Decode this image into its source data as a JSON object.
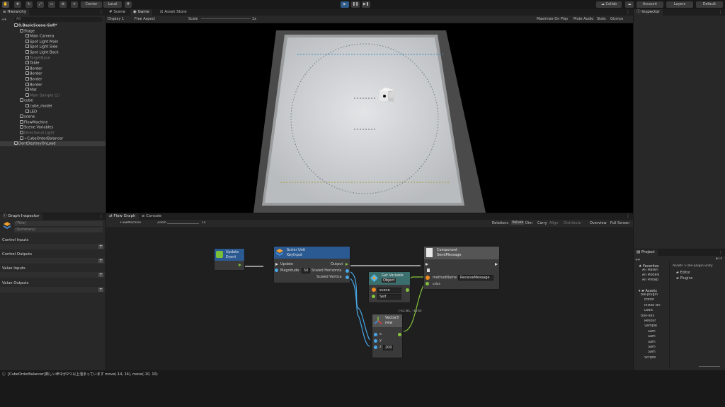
{
  "toolbar": {
    "center_label": "Center",
    "local_label": "Local",
    "collab_label": "Collab",
    "account_label": "Account",
    "layers_label": "Layers",
    "layout_label": "Default"
  },
  "hierarchy": {
    "tab_label": "Hierarchy",
    "search_placeholder": "All",
    "items": [
      {
        "label": "0.BasicScene-Sofi*",
        "indent": 0,
        "bold": true
      },
      {
        "label": "Stage",
        "indent": 1
      },
      {
        "label": "Main Camera",
        "indent": 2
      },
      {
        "label": "Spot Light Main",
        "indent": 2
      },
      {
        "label": "Spot Light Side",
        "indent": 2
      },
      {
        "label": "Spot Light Back",
        "indent": 2
      },
      {
        "label": "TargetBase",
        "indent": 2,
        "dim": true
      },
      {
        "label": "Table",
        "indent": 2
      },
      {
        "label": "Border",
        "indent": 2
      },
      {
        "label": "Border",
        "indent": 2
      },
      {
        "label": "Border",
        "indent": 2
      },
      {
        "label": "Border",
        "indent": 2
      },
      {
        "label": "Mat",
        "indent": 2
      },
      {
        "label": "Main Sample (1)",
        "indent": 2,
        "dim": true
      },
      {
        "label": "cube",
        "indent": 1
      },
      {
        "label": "cube_model",
        "indent": 2
      },
      {
        "label": "LED",
        "indent": 2
      },
      {
        "label": "scene",
        "indent": 1
      },
      {
        "label": "FlowMachine",
        "indent": 1
      },
      {
        "label": "Scene Variables",
        "indent": 1
      },
      {
        "label": "Directional Light",
        "indent": 1,
        "dim": true
      },
      {
        "label": "~CubeOrderBalancer",
        "indent": 1
      },
      {
        "label": "DontDestroyOnLoad",
        "indent": 0,
        "sel": true
      }
    ]
  },
  "scene_tabs": [
    "Scene",
    "Game",
    "Asset Store"
  ],
  "game_toolbar": {
    "display": "Display 1",
    "aspect": "Free Aspect",
    "scale_label": "Scale",
    "scale_value": "1x",
    "maximize": "Maximize On Play",
    "mute": "Mute Audio",
    "stats": "Stats",
    "gizmos": "Gizmos"
  },
  "inspector": {
    "tab_label": "Inspector"
  },
  "graph_inspector": {
    "tab_label": "Graph Inspector",
    "title_placeholder": "(Title)",
    "summary_placeholder": "(Summary)",
    "sections": [
      "Control Inputs",
      "Control Outputs",
      "Value Inputs",
      "Value Outputs"
    ]
  },
  "flow_tabs": [
    "Flow Graph",
    "Console"
  ],
  "flow_toolbar": {
    "graph_name": "FlowMachine",
    "zoom_label": "Zoom",
    "zoom_value": "1x",
    "buttons": [
      "Relations",
      "Values",
      "Dim",
      "Carry",
      "Align",
      "Distribute",
      "Overview",
      "Full Screen"
    ]
  },
  "nodes": {
    "update": {
      "title": "Update",
      "subtitle": "Event"
    },
    "keyinput": {
      "title": "Scrier Unit",
      "subtitle": "KeyInput",
      "in_update": "Update",
      "in_magnitude": "Magnitude",
      "magnitude_value": "50",
      "out_output": "Output",
      "out_h": "Scaled Horizonta",
      "out_v": "Scaled Vertica"
    },
    "getvar": {
      "title": "Get Variable",
      "subtitle": "Object",
      "kind": "Object",
      "name_value": "scene",
      "target_value": "Self"
    },
    "sendmsg": {
      "title": "Component",
      "subtitle": "SendMessage",
      "param_label": "methodName",
      "method_value": "ReceiveMessage",
      "value_label": "value"
    },
    "vector": {
      "title": "Vector3",
      "subtitle": "new",
      "x_label": "x",
      "y_label": "y",
      "z_label": "z",
      "z_value": "200"
    },
    "vector_readout": "(-11.61, -10.6)"
  },
  "project": {
    "tab_label": "Project",
    "count": "14",
    "breadcrumb": "Assets > ble-plugin-unity",
    "favorites_label": "Favorites",
    "favorites": [
      "All Materi",
      "All Models",
      "All Prefab"
    ],
    "assets_label": "Assets",
    "asset_tree": [
      "ble-plugin",
      "Editor",
      "Install Bri",
      "Lodic",
      "toio-sdk",
      "Resour",
      "Sample",
      "Sam",
      "Sam",
      "Sam",
      "Sam",
      "Sam",
      "Scripts"
    ],
    "folders": [
      "Editor",
      "Plugins"
    ]
  },
  "status": {
    "message": "[CubeOrderBalancer]新しい命令が2つ以上溜まっています move(-14, 14), move(-10, 10)"
  }
}
